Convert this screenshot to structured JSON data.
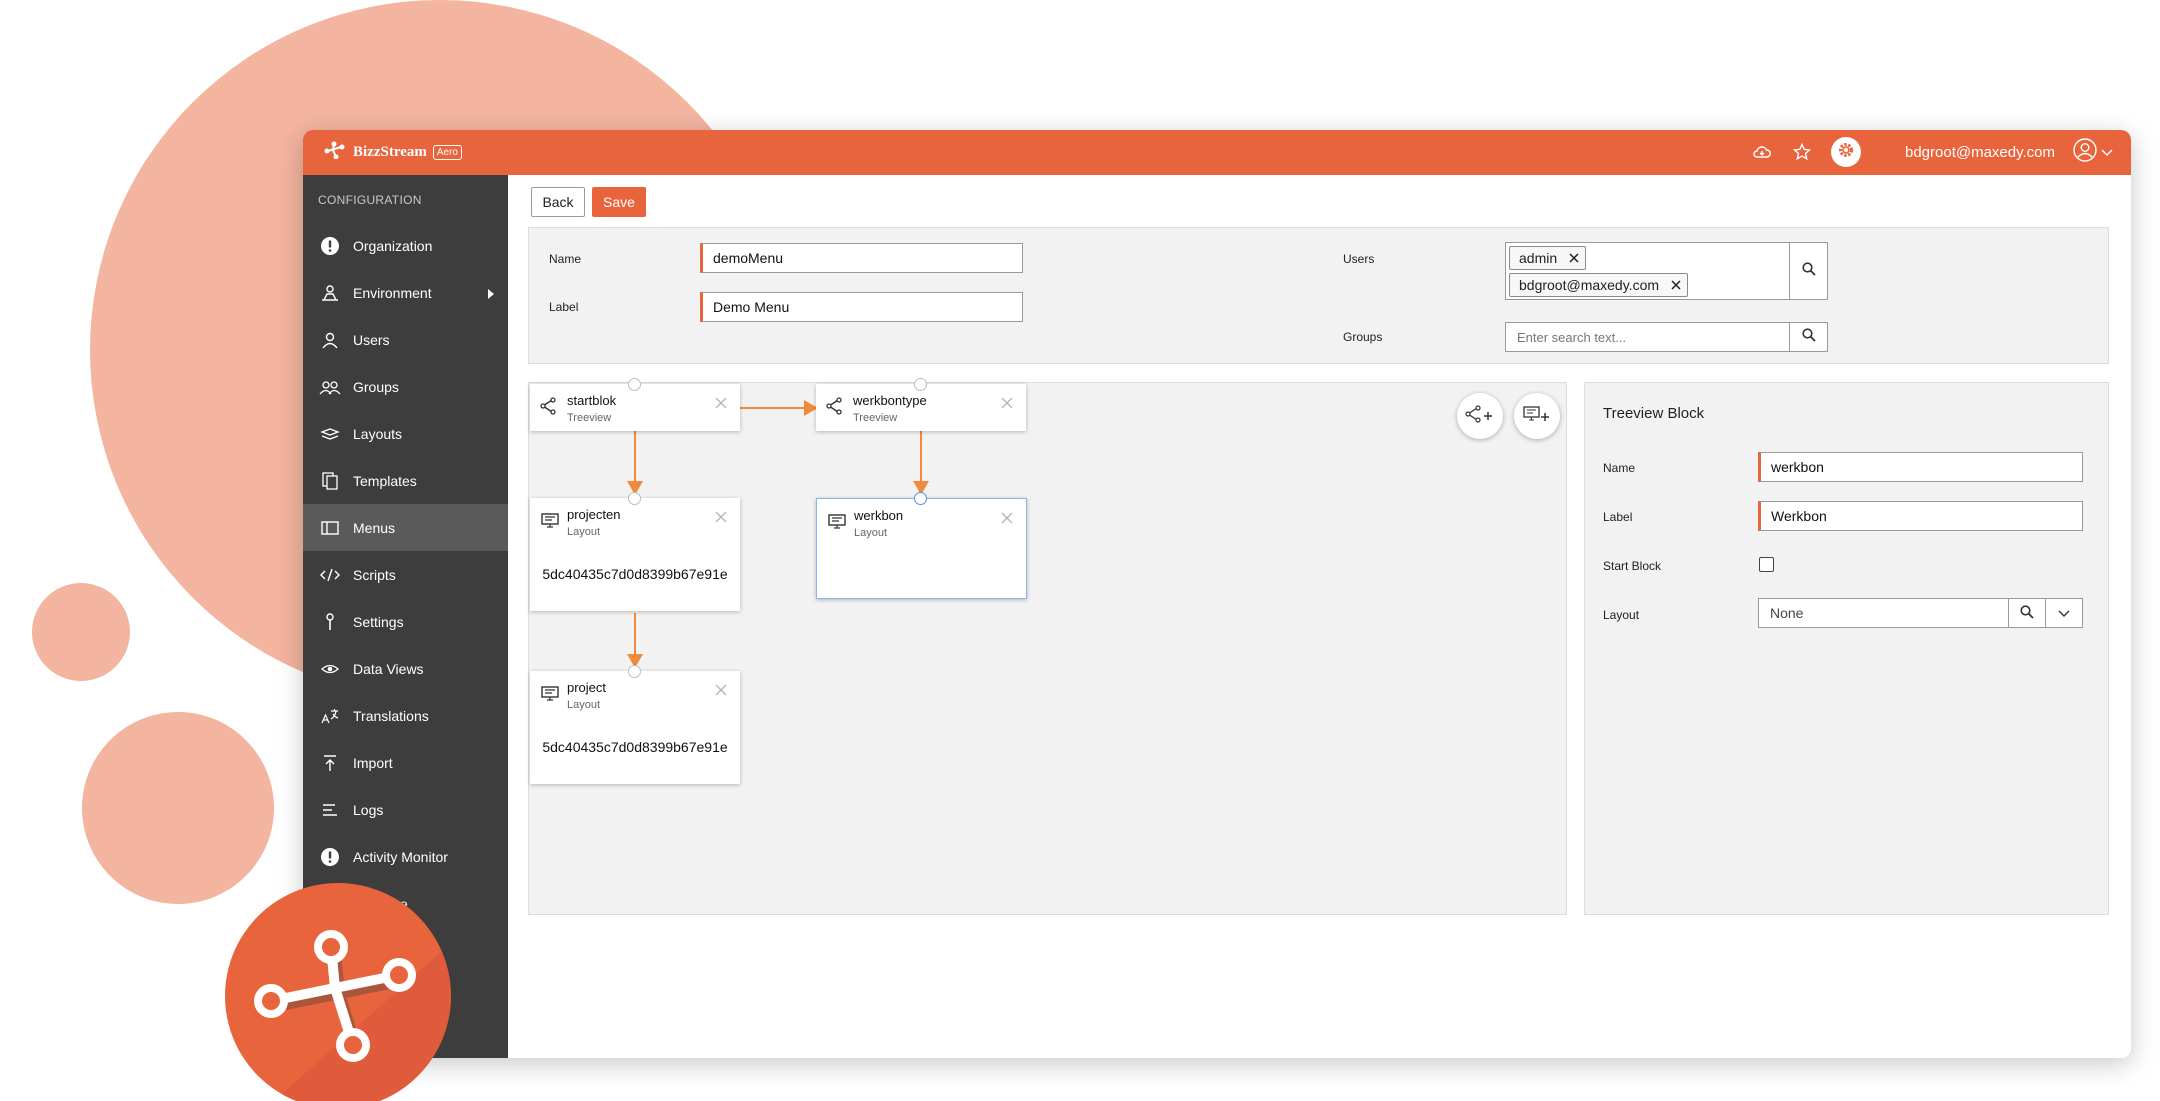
{
  "brand": {
    "name": "BizzStream",
    "badge": "Aero"
  },
  "header": {
    "user_email": "bdgroot@maxedy.com"
  },
  "sidebar": {
    "heading": "CONFIGURATION",
    "items": [
      {
        "label": "Organization",
        "icon": "alert-circle-icon"
      },
      {
        "label": "Environment",
        "icon": "environment-icon"
      },
      {
        "label": "Users",
        "icon": "user-icon"
      },
      {
        "label": "Groups",
        "icon": "group-icon"
      },
      {
        "label": "Layouts",
        "icon": "layers-icon"
      },
      {
        "label": "Templates",
        "icon": "templates-icon"
      },
      {
        "label": "Menus",
        "icon": "menu-icon"
      },
      {
        "label": "Scripts",
        "icon": "code-icon"
      },
      {
        "label": "Settings",
        "icon": "settings-icon"
      },
      {
        "label": "Data Views",
        "icon": "eye-icon"
      },
      {
        "label": "Translations",
        "icon": "translate-icon"
      },
      {
        "label": "Import",
        "icon": "import-icon"
      },
      {
        "label": "Logs",
        "icon": "logs-icon"
      },
      {
        "label": "Activity Monitor",
        "icon": "alert-circle-icon"
      },
      {
        "label": "ce",
        "icon": ""
      }
    ]
  },
  "toolbar": {
    "back_label": "Back",
    "save_label": "Save"
  },
  "form": {
    "name_label": "Name",
    "name_value": "demoMenu",
    "label_label": "Label",
    "label_value": "Demo Menu",
    "users_label": "Users",
    "users": [
      "admin",
      "bdgroot@maxedy.com"
    ],
    "groups_label": "Groups",
    "groups_placeholder": "Enter search text..."
  },
  "canvas": {
    "nodes": [
      {
        "title": "startblok",
        "type": "Treeview",
        "value": ""
      },
      {
        "title": "werkbontype",
        "type": "Treeview",
        "value": ""
      },
      {
        "title": "projecten",
        "type": "Layout",
        "value": "5dc40435c7d0d8399b67e91e"
      },
      {
        "title": "werkbon",
        "type": "Layout",
        "value": ""
      },
      {
        "title": "project",
        "type": "Layout",
        "value": "5dc40435c7d0d8399b67e91e"
      }
    ]
  },
  "properties": {
    "title": "Treeview Block",
    "name_label": "Name",
    "name_value": "werkbon",
    "label_label": "Label",
    "label_value": "Werkbon",
    "start_block_label": "Start Block",
    "start_block_checked": false,
    "layout_label": "Layout",
    "layout_value": "None"
  },
  "colors": {
    "accent": "#e8643c",
    "sidebar": "#3d3d3d",
    "panel": "#f2f2f2",
    "selected_border": "#8cb4ee"
  }
}
